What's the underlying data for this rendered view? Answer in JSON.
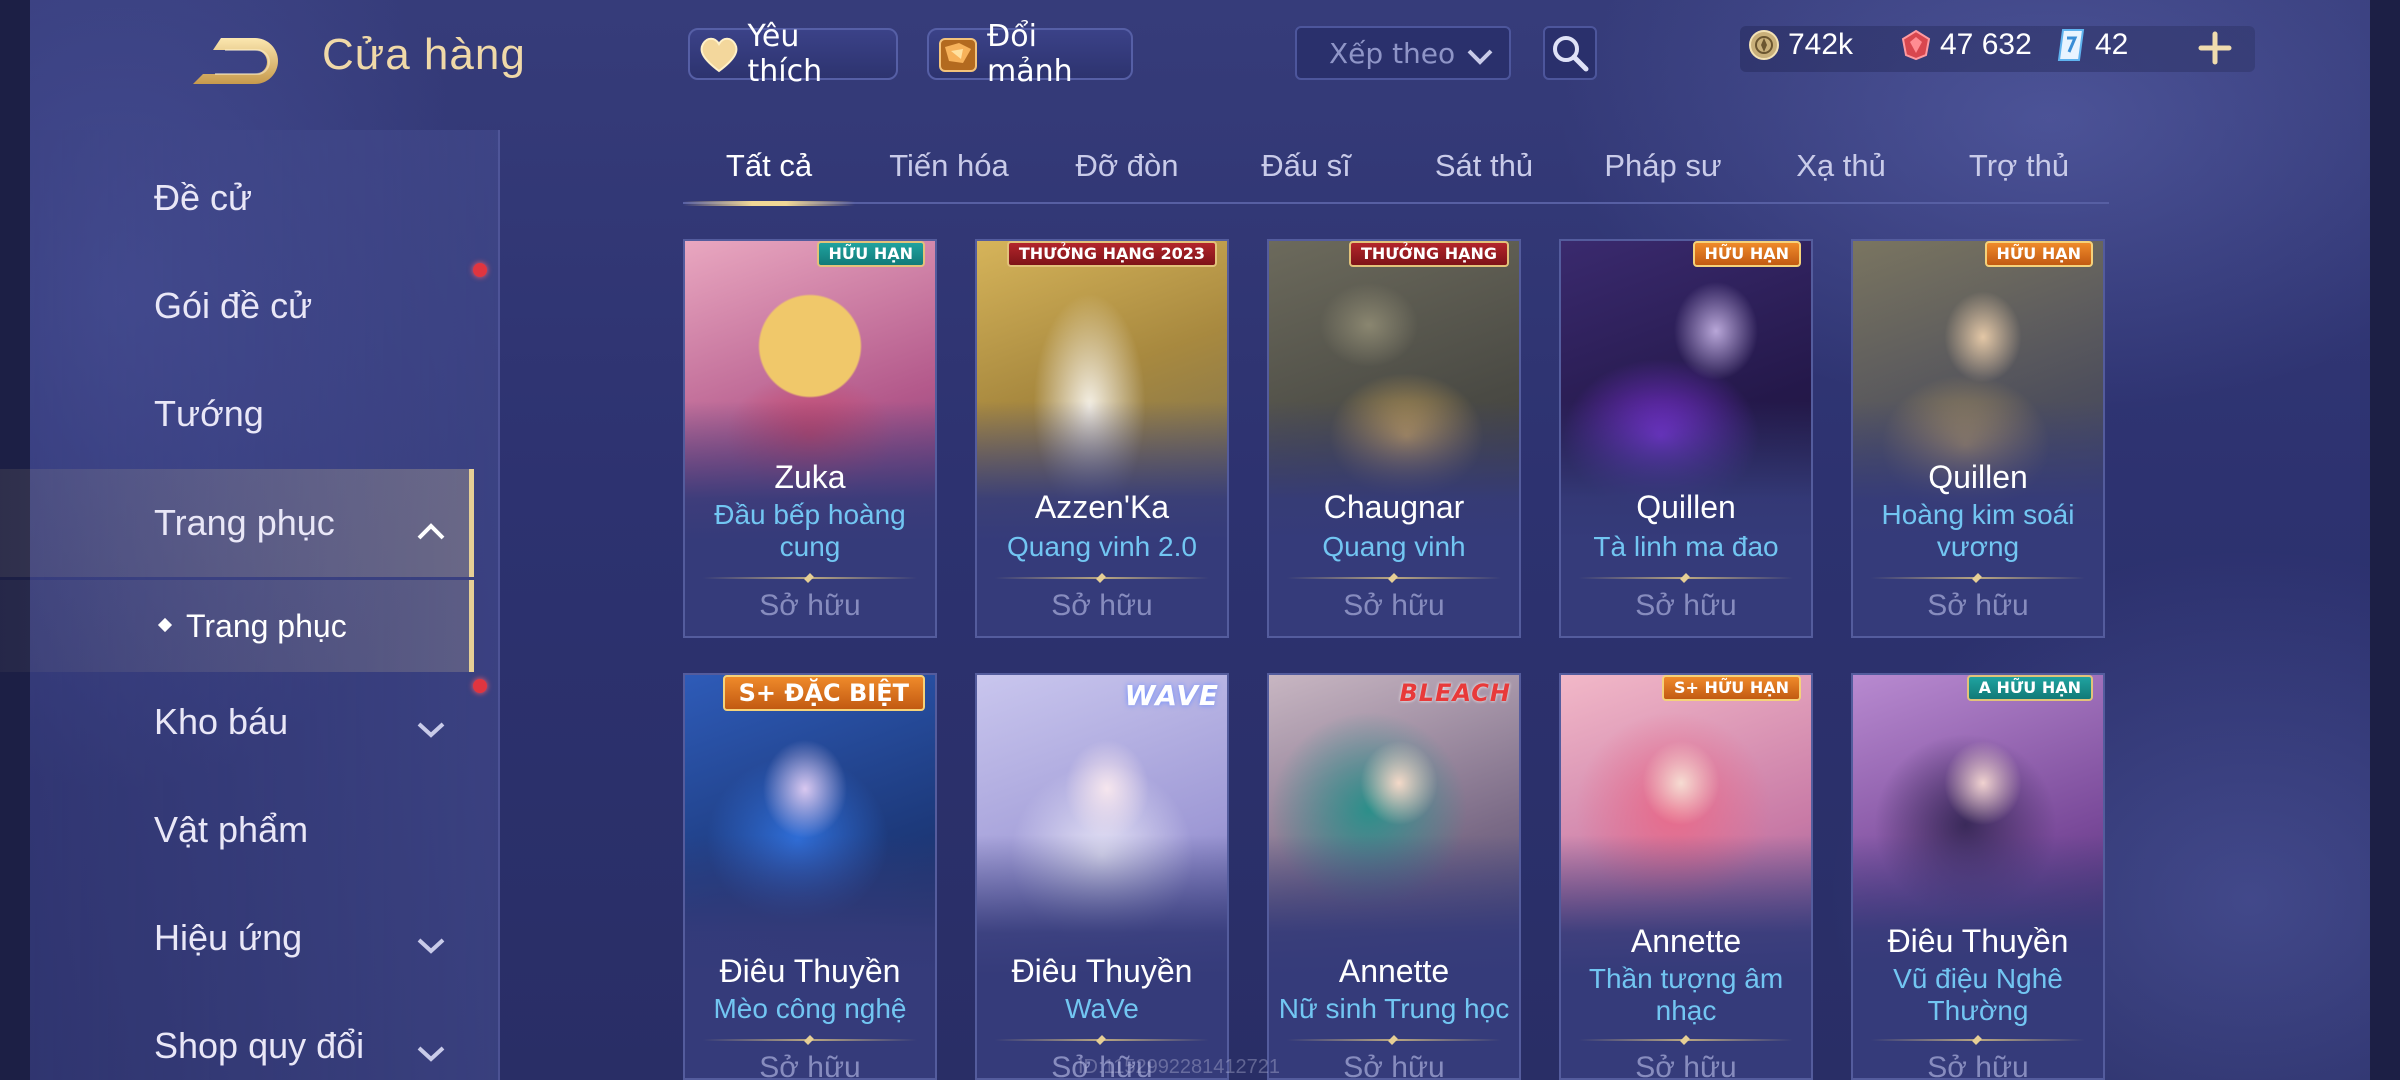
{
  "header": {
    "title": "Cửa hàng",
    "favorite_label": "Yêu thích",
    "exchange_label": "Đổi mảnh",
    "sort_placeholder": "Xếp theo",
    "currencies": [
      {
        "icon": "gold-coin-icon",
        "value": "742k"
      },
      {
        "icon": "red-gem-icon",
        "value": "47 632"
      },
      {
        "icon": "blue-voucher-icon",
        "value": "42"
      }
    ]
  },
  "sidebar": {
    "items": [
      {
        "label": "Đề cử"
      },
      {
        "label": "Gói đề cử"
      },
      {
        "label": "Tướng"
      },
      {
        "label": "Trang phục"
      },
      {
        "label": "Kho báu"
      },
      {
        "label": "Vật phẩm"
      },
      {
        "label": "Hiệu ứng"
      },
      {
        "label": "Shop quy đổi"
      }
    ],
    "sub_item": "Trang phục"
  },
  "tabs": [
    "Tất cả",
    "Tiến hóa",
    "Đỡ đòn",
    "Đấu sĩ",
    "Sát thủ",
    "Pháp sư",
    "Xạ thủ",
    "Trợ thủ"
  ],
  "cards": [
    {
      "hero": "Zuka",
      "skin": "Đầu bếp hoàng cung",
      "status": "Sở hữu",
      "badge": "HỮU HẠN"
    },
    {
      "hero": "Azzen'Ka",
      "skin": "Quang vinh 2.0",
      "status": "Sở hữu",
      "badge": "THƯỞNG HẠNG 2023"
    },
    {
      "hero": "Chaugnar",
      "skin": "Quang vinh",
      "status": "Sở hữu",
      "badge": "THƯỞNG HẠNG"
    },
    {
      "hero": "Quillen",
      "skin": "Tà linh ma đao",
      "status": "Sở hữu",
      "badge": "HỮU HẠN"
    },
    {
      "hero": "Quillen",
      "skin": "Hoàng kim soái vương",
      "status": "Sở hữu",
      "badge": "HỮU HẠN"
    },
    {
      "hero": "Điêu Thuyền",
      "skin": "Mèo công nghệ",
      "status": "Sở hữu",
      "badge": "S+ ĐẶC BIỆT"
    },
    {
      "hero": "Điêu Thuyền",
      "skin": "WaVe",
      "status": "Sở hữu",
      "badge": "WAVE"
    },
    {
      "hero": "Annette",
      "skin": "Nữ sinh Trung học",
      "status": "Sở hữu",
      "badge": "BLEACH"
    },
    {
      "hero": "Annette",
      "skin": "Thần tượng âm nhạc",
      "status": "Sở hữu",
      "badge": "S+ HỮU HẠN"
    },
    {
      "hero": "Điêu Thuyền",
      "skin": "Vũ điệu Nghê Thường",
      "status": "Sở hữu",
      "badge": "A HỮU HẠN"
    }
  ],
  "watermark": "ID:1152992281412721"
}
